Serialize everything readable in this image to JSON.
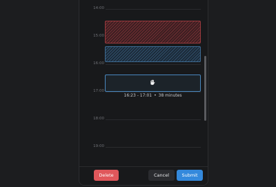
{
  "timeline": {
    "hours": [
      "14:00",
      "15:00",
      "16:00",
      "17:00",
      "18:00",
      "19:00"
    ]
  },
  "selection": {
    "start": "16:23",
    "end": "17:01",
    "separator": "•",
    "duration": "38 minutes"
  },
  "events": [
    {
      "color": "#9b3a3e",
      "style": "hatched"
    },
    {
      "color": "#3d6a92",
      "style": "hatched"
    }
  ],
  "footer": {
    "delete_label": "Delete",
    "cancel_label": "Cancel",
    "submit_label": "Submit"
  },
  "colors": {
    "delete": "#e0575b",
    "submit": "#3489dc",
    "new_event_border": "#4a88c0"
  },
  "icons": {
    "drag": "grab-hand-icon"
  }
}
